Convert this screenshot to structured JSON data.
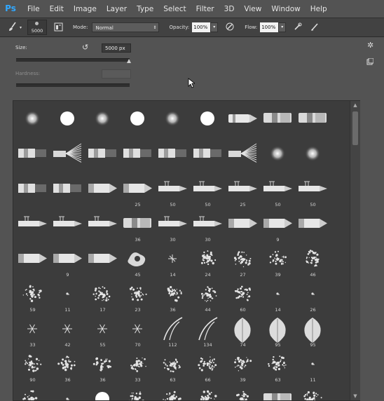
{
  "app": {
    "logo": "Ps"
  },
  "menubar": {
    "items": [
      "File",
      "Edit",
      "Image",
      "Layer",
      "Type",
      "Select",
      "Filter",
      "3D",
      "View",
      "Window",
      "Help"
    ]
  },
  "options_bar": {
    "brush_size_value": "5000",
    "mode_label": "Mode:",
    "mode_value": "Normal",
    "opacity_label": "Opacity:",
    "opacity_value": "100%",
    "flow_label": "Flow:",
    "flow_value": "100%"
  },
  "brush_panel": {
    "size_label": "Size:",
    "size_value": "5000 px",
    "size_slider_fraction": 1.0,
    "hardness_label": "Hardness:"
  },
  "preset_grid": {
    "rows": [
      [
        {
          "t": "soft"
        },
        {
          "t": "hard"
        },
        {
          "t": "soft"
        },
        {
          "t": "hard"
        },
        {
          "t": "soft"
        },
        {
          "t": "hard"
        },
        {
          "t": "tip"
        },
        {
          "t": "chisel"
        },
        {
          "t": "chisel"
        }
      ],
      [
        {
          "t": "bristle"
        },
        {
          "t": "fan"
        },
        {
          "t": "bristle"
        },
        {
          "t": "bristle"
        },
        {
          "t": "bristle"
        },
        {
          "t": "bristle"
        },
        {
          "t": "fan"
        },
        {
          "t": "soft"
        },
        {
          "t": "soft"
        }
      ],
      [
        {
          "t": "bristle"
        },
        {
          "t": "bristle"
        },
        {
          "t": "pencil"
        },
        {
          "t": "pencil",
          "n": "25"
        },
        {
          "t": "pen",
          "n": "50"
        },
        {
          "t": "pen",
          "n": "50"
        },
        {
          "t": "pen",
          "n": "25"
        },
        {
          "t": "pen",
          "n": "50"
        },
        {
          "t": "pen",
          "n": "50"
        }
      ],
      [
        {
          "t": "pen"
        },
        {
          "t": "pen"
        },
        {
          "t": "pen"
        },
        {
          "t": "chisel",
          "n": "36"
        },
        {
          "t": "pen",
          "n": "30"
        },
        {
          "t": "pen",
          "n": "30"
        },
        {
          "t": "pencil"
        },
        {
          "t": "pencil",
          "n": "9"
        },
        {
          "t": "pencil"
        }
      ],
      [
        {
          "t": "pencil"
        },
        {
          "t": "pencil",
          "n": "9"
        },
        {
          "t": "pencil"
        },
        {
          "t": "blob",
          "n": "45"
        },
        {
          "t": "spark",
          "n": "14"
        },
        {
          "t": "splat",
          "n": "24"
        },
        {
          "t": "splat",
          "n": "27"
        },
        {
          "t": "splat",
          "n": "39"
        },
        {
          "t": "splat",
          "n": "46"
        }
      ],
      [
        {
          "t": "splat",
          "n": "59"
        },
        {
          "t": "dot",
          "n": "11"
        },
        {
          "t": "splat",
          "n": "17"
        },
        {
          "t": "splat",
          "n": "23"
        },
        {
          "t": "splat",
          "n": "36"
        },
        {
          "t": "splat",
          "n": "44"
        },
        {
          "t": "splat",
          "n": "60"
        },
        {
          "t": "dot",
          "n": "14"
        },
        {
          "t": "dot",
          "n": "26"
        }
      ],
      [
        {
          "t": "star",
          "n": "33"
        },
        {
          "t": "star",
          "n": "42"
        },
        {
          "t": "star",
          "n": "55"
        },
        {
          "t": "star",
          "n": "70"
        },
        {
          "t": "grass",
          "n": "112"
        },
        {
          "t": "grass",
          "n": "134"
        },
        {
          "t": "leaf",
          "n": "74"
        },
        {
          "t": "leaf",
          "n": "95"
        },
        {
          "t": "leaf",
          "n": "95"
        }
      ],
      [
        {
          "t": "splat",
          "n": "90"
        },
        {
          "t": "splat",
          "n": "36"
        },
        {
          "t": "splat",
          "n": "36"
        },
        {
          "t": "splat",
          "n": "33"
        },
        {
          "t": "splat",
          "n": "63"
        },
        {
          "t": "splat",
          "n": "66"
        },
        {
          "t": "splat",
          "n": "39"
        },
        {
          "t": "splat",
          "n": "63"
        },
        {
          "t": "dot",
          "n": "11"
        }
      ],
      [
        {
          "t": "splat"
        },
        {
          "t": "dot"
        },
        {
          "t": "hard"
        },
        {
          "t": "splat"
        },
        {
          "t": "splat"
        },
        {
          "t": "splat"
        },
        {
          "t": "splat"
        },
        {
          "t": "chisel"
        },
        {
          "t": "splat"
        }
      ]
    ]
  },
  "icons": {
    "brush_tool": "brush-icon",
    "brush_panel_toggle": "brush-panel-icon",
    "reset_size": "reset-icon",
    "settings": "gear-icon",
    "new_preset": "new-preset-icon",
    "airbrush": "airbrush-icon",
    "pressure_opacity": "pressure-icon",
    "pressure_size": "pressure-size-icon"
  }
}
